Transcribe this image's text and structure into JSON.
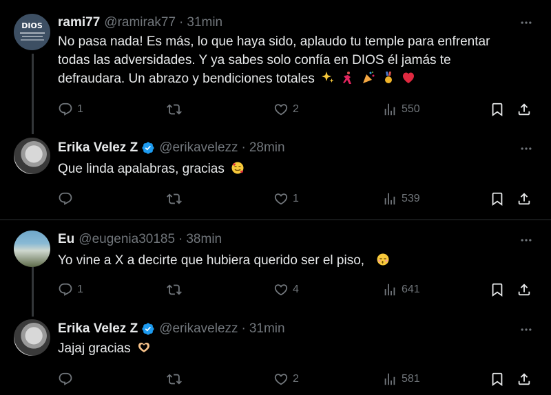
{
  "posts": [
    {
      "name": "rami77",
      "handle": "@ramirak77",
      "time": "31min",
      "avatar_text": "DIOS",
      "lines": [
        "No pasa nada! Es más, lo que haya sido, aplaudo tu temple para enfrentar",
        "todas las adversidades. Y ya sabes solo confía en DIOS él jamás te",
        "defraudara. Un abrazo y bendiciones totales"
      ],
      "emojis": [
        "sparkles",
        "dancer",
        "party-popper",
        "medal",
        "red-heart"
      ],
      "replies": "1",
      "retweets": "",
      "likes": "2",
      "views": "550"
    },
    {
      "name": "Erika Velez Z",
      "handle": "@erikavelezz",
      "time": "28min",
      "lines": [
        "Que linda apalabras, gracias"
      ],
      "emojis": [
        "smiling-face-with-hearts"
      ],
      "replies": "",
      "retweets": "",
      "likes": "1",
      "views": "539"
    },
    {
      "name": "Eu",
      "handle": "@eugenia30185",
      "time": "38min",
      "lines": [
        "Yo vine a X a decirte que hubiera querido ser el piso,"
      ],
      "emojis": [
        "kissing-face"
      ],
      "replies": "1",
      "retweets": "",
      "likes": "4",
      "views": "641"
    },
    {
      "name": "Erika Velez Z",
      "handle": "@erikavelezz",
      "time": "31min",
      "lines": [
        "Jajaj gracias"
      ],
      "emojis": [
        "heart-hands"
      ],
      "replies": "",
      "retweets": "",
      "likes": "2",
      "views": "581"
    }
  ],
  "colors": {
    "background": "#000000",
    "text": "#e7e9ea",
    "muted": "#71767b",
    "verified": "#1d9bf0",
    "divider": "#2f3336"
  }
}
